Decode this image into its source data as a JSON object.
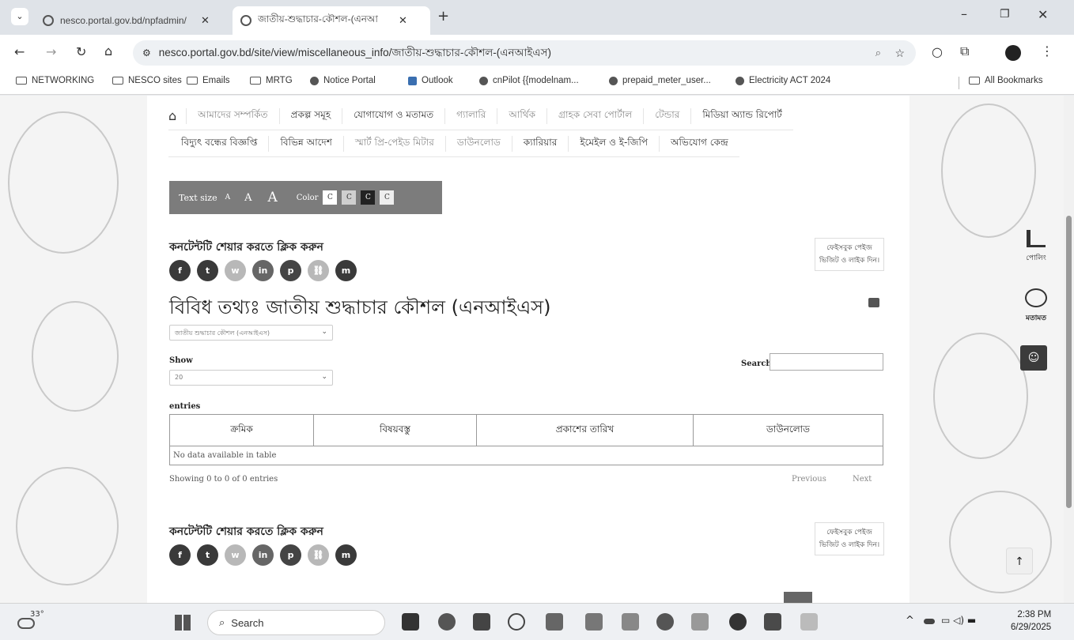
{
  "browser": {
    "tabs": [
      {
        "title": "nesco.portal.gov.bd/npfadmin/"
      },
      {
        "title": "জাতীয়-শুদ্ধাচার-কৌশল-(এনআ"
      }
    ],
    "url": "nesco.portal.gov.bd/site/view/miscellaneous_info/জাতীয়-শুদ্ধাচার-কৌশল-(এনআইএস)",
    "bookmarks": [
      "NETWORKING",
      "NESCO sites",
      "Emails",
      "MRTG",
      "Notice Portal",
      "Outlook",
      "cnPilot {{modelnam...",
      "prepaid_meter_user...",
      "Electricity ACT 2024"
    ],
    "all_bookmarks": "All Bookmarks"
  },
  "nav": {
    "row1": [
      "আমাদের সম্পর্কিত",
      "প্রকল্প সমূহ",
      "যোগাযোগ ও মতামত",
      "গ্যালারি",
      "আর্থিক",
      "গ্রাহক সেবা পোর্টাল",
      "টেন্ডার",
      "মিডিয়া অ্যান্ড রিপোর্ট"
    ],
    "row2": [
      "বিদ্যুৎ বন্ধের বিজ্ঞপ্তি",
      "বিভিন্ন আদেশ",
      "স্মার্ট প্রি-পেইড মিটার",
      "ডাউনলোড",
      "ক্যারিয়ার",
      "ইমেইল ও ই-জিপি",
      "অভিযোগ কেন্দ্র"
    ]
  },
  "accessibility": {
    "text_size_label": "Text size",
    "sizes": [
      "A",
      "A",
      "A"
    ],
    "color_label": "Color",
    "color_letter": "C"
  },
  "share": {
    "title": "কনটেন্টটি শেয়ার করতে ক্লিক করুন",
    "facebook_box": "ফেইসবুক পেইজ ভিজিট ও লাইক দিন।"
  },
  "page": {
    "title": "বিবিধ তথ্যঃ জাতীয় শুদ্ধাচার কৌশল (এনআইএস)",
    "category_select": "জাতীয় শুদ্ধাচার কৌশল (এনআইএস)",
    "show_label": "Show",
    "show_value": "20",
    "entries_label": "entries",
    "search_label": "Search:"
  },
  "table": {
    "headers": [
      "ক্রমিক",
      "বিষয়বস্তু",
      "প্রকাশের তারিখ",
      "ডাউনলোড"
    ],
    "empty_text": "No data available in table",
    "info": "Showing 0 to 0 of 0 entries",
    "prev": "Previous",
    "next": "Next"
  },
  "side_widgets": {
    "poll": "পোলিং",
    "feedback": "মতামত"
  },
  "taskbar": {
    "weather": "33°",
    "search_placeholder": "Search",
    "time": "2:38 PM",
    "date": "6/29/2025"
  }
}
